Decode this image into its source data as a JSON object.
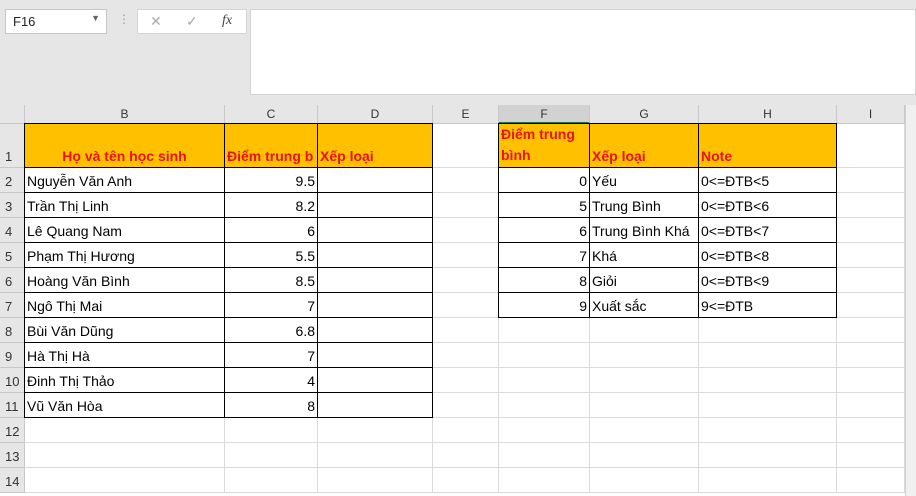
{
  "name_box": "F16",
  "formula_buttons": {
    "cancel": "✕",
    "enter": "✓",
    "fx": "fx"
  },
  "columns": [
    "B",
    "C",
    "D",
    "E",
    "F",
    "G",
    "H",
    "I"
  ],
  "selected_column": "F",
  "rows": [
    "1",
    "2",
    "3",
    "4",
    "5",
    "6",
    "7",
    "8",
    "9",
    "10",
    "11",
    "12",
    "13",
    "14"
  ],
  "students_table": {
    "headers": [
      "Họ và tên học sinh",
      "Điểm trung b",
      "Xếp loại"
    ],
    "rows": [
      [
        "Nguyễn Văn Anh",
        "9.5",
        ""
      ],
      [
        "Trần Thị Linh",
        "8.2",
        ""
      ],
      [
        "Lê Quang Nam",
        "6",
        ""
      ],
      [
        "Phạm Thị Hương",
        "5.5",
        ""
      ],
      [
        "Hoàng Văn Bình",
        "8.5",
        ""
      ],
      [
        "Ngô Thị Mai",
        "7",
        ""
      ],
      [
        "Bùi Văn Dũng",
        "6.8",
        ""
      ],
      [
        "Hà Thị Hà",
        "7",
        ""
      ],
      [
        "Đinh Thị Thảo",
        "4",
        ""
      ],
      [
        "Vũ Văn Hòa",
        "8",
        ""
      ]
    ]
  },
  "grading_table": {
    "headers": [
      "Điểm trung bình",
      "Xếp loại",
      "Note"
    ],
    "rows": [
      [
        "0",
        "Yếu",
        "0<=ĐTB<5"
      ],
      [
        "5",
        "Trung Bình",
        "0<=ĐTB<6"
      ],
      [
        "6",
        "Trung Bình Khá",
        "0<=ĐTB<7"
      ],
      [
        "7",
        "Khá",
        "0<=ĐTB<8"
      ],
      [
        "8",
        "Giỏi",
        "0<=ĐTB<9"
      ],
      [
        "9",
        "Xuất sắc",
        "9<=ĐTB"
      ]
    ]
  }
}
